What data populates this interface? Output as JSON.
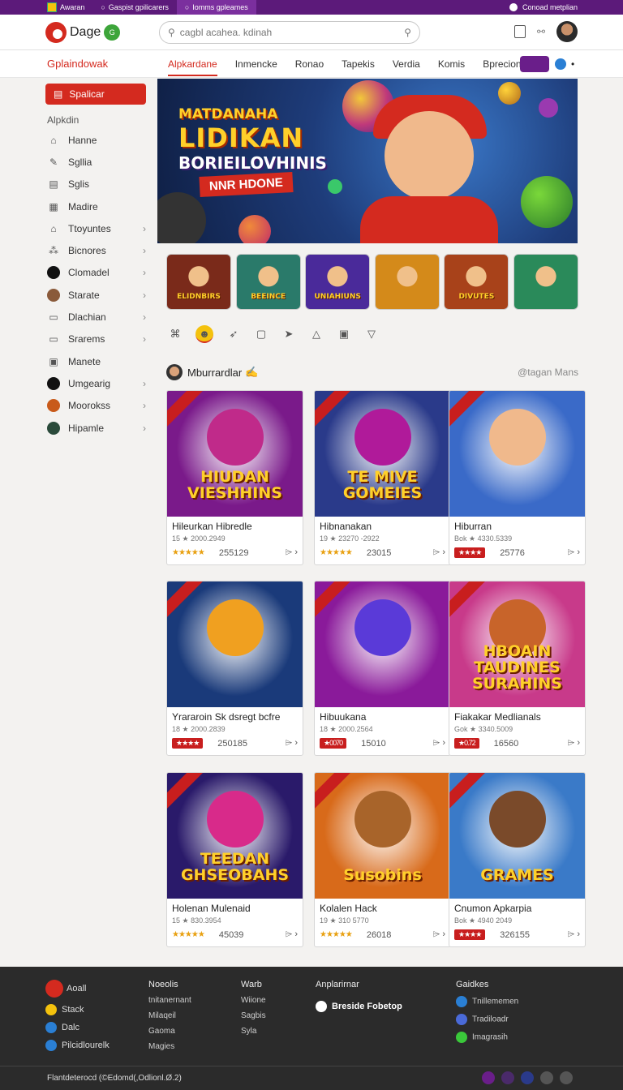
{
  "topbar": {
    "tabs": [
      "Awaran",
      "Gaspist gpilicarers",
      "Iomms gpleames"
    ],
    "right_text": "Conoad metplian"
  },
  "header": {
    "logo_text": "Dage",
    "logo_badge": "G",
    "search_placeholder": "cagbl acahea. kdinah"
  },
  "nav": {
    "brand": "Gplaindowak",
    "items": [
      "Alpkardane",
      "Inmencke",
      "Ronao",
      "Tapekis",
      "Verdia",
      "Komis",
      "Bprecion"
    ],
    "more_glyph": "⌄",
    "extra_glyph": "•"
  },
  "sidebar": {
    "button_label": "Spalicar",
    "heading": "Alpkdin",
    "items": [
      {
        "label": "Hanne",
        "icon": "home-icon",
        "chevron": false
      },
      {
        "label": "Sgllia",
        "icon": "edit-icon",
        "chevron": false
      },
      {
        "label": "Sglis",
        "icon": "document-icon",
        "chevron": false
      },
      {
        "label": "Madire",
        "icon": "grid-icon",
        "chevron": false
      },
      {
        "label": "Ttoyuntes",
        "icon": "home-icon",
        "chevron": true
      },
      {
        "label": "Bicnores",
        "icon": "cluster-icon",
        "chevron": true
      },
      {
        "label": "Clomadel",
        "icon": "circle-dark-icon",
        "chevron": true
      },
      {
        "label": "Starate",
        "icon": "avatar-icon",
        "chevron": true
      },
      {
        "label": "Dlachian",
        "icon": "folder-icon",
        "chevron": true
      },
      {
        "label": "Srarems",
        "icon": "card-icon",
        "chevron": true
      },
      {
        "label": "Manete",
        "icon": "image-icon",
        "chevron": false
      },
      {
        "label": "Umgearig",
        "icon": "shield-icon",
        "chevron": true
      },
      {
        "label": "Moorokss",
        "icon": "orange-badge-icon",
        "chevron": true
      },
      {
        "label": "Hipamle",
        "icon": "globe-icon",
        "chevron": true
      }
    ]
  },
  "banner": {
    "line1": "MATDANAHA",
    "line2": "LIDIKAN",
    "line3": "BORIEILOVHINIS",
    "ribbon": "NNR HDONE"
  },
  "thumbs": [
    {
      "label": "ELIDNBIRS",
      "bg": "#7a2a1a"
    },
    {
      "label": "BEEINCE",
      "bg": "#2a7a6a"
    },
    {
      "label": "UNIAHIUNS",
      "bg": "#4a2a9a"
    },
    {
      "label": "",
      "bg": "#d48a1a"
    },
    {
      "label": "DIVUTES",
      "bg": "#a8421a"
    },
    {
      "label": "",
      "bg": "#2a8a5a"
    }
  ],
  "tools": [
    "controller-icon",
    "emoji-icon",
    "rocket-icon",
    "square-icon",
    "pin-icon",
    "flask-icon",
    "box-icon",
    "triangle-icon"
  ],
  "section": {
    "title": "Mburrardlar",
    "title_glyph": "✍",
    "right": "@tagan Mans"
  },
  "cards": [
    {
      "art": "HIUDAN VIESHHINS",
      "bg": "#7a1a8a",
      "char": "#c02a8a",
      "name": "Hileurkan Hibredle",
      "meta": "15 ★ 2000.2949",
      "rating": "★★★★★",
      "badge": false,
      "count": "255129"
    },
    {
      "art": "TE MIVE GOMEIES",
      "bg": "#2a3a8a",
      "char": "#b01a9a",
      "name": "Hibnanakan",
      "meta": "19 ★ 23270 -2922",
      "rating": "★★★★★",
      "badge": false,
      "count": "23015"
    },
    {
      "art": "",
      "bg": "#3a6ac8",
      "char": "#f0b98c",
      "name": "Hiburran",
      "meta": "Bok ★ 4330.5339",
      "rating": "★★★★",
      "badge": true,
      "count": "25776"
    },
    {
      "art": "",
      "bg": "#1a3a7a",
      "char": "#f0a020",
      "name": "Yrararoin Sk dsregt bcfre",
      "meta": "18 ★ 2000.2839",
      "rating": "★★★★",
      "badge": true,
      "count": "250185"
    },
    {
      "art": "",
      "bg": "#8a1a9a",
      "char": "#5a3ad8",
      "name": "Hibuukana",
      "meta": "18 ★ 2000.2564",
      "rating": "★0070",
      "badge": true,
      "count": "15010"
    },
    {
      "art": "HBOAIN TAUDINES SURAHINS",
      "bg": "#c83a8a",
      "char": "#c8642a",
      "name": "Fiakakar Medlianals",
      "meta": "Gok ★ 3340.5009",
      "rating": "★0.72",
      "badge": true,
      "count": "16560"
    },
    {
      "art": "TEEDAN GHSEOBAHS",
      "bg": "#2a1a6a",
      "char": "#d82a8a",
      "name": "Holenan Mulenaid",
      "meta": "15 ★ 830.3954",
      "rating": "★★★★★",
      "badge": false,
      "count": "45039"
    },
    {
      "art": "Susobins",
      "bg": "#d86a1a",
      "char": "#a8642a",
      "name": "Kolalen Hack",
      "meta": "19 ★ 310 5770",
      "rating": "★★★★★",
      "badge": false,
      "count": "26018"
    },
    {
      "art": "GRAMES",
      "bg": "#3a7ac8",
      "char": "#7a4a2a",
      "name": "Cnumon Apkarpia",
      "meta": "Bok ★ 4940 2049",
      "rating": "★★★★",
      "badge": true,
      "count": "326155"
    }
  ],
  "footer": {
    "col1": {
      "brand": "Aoall",
      "items": [
        "Stack",
        "Dalc",
        "Pilcidlourelk"
      ]
    },
    "col2": {
      "head": "Noeolis",
      "items": [
        "tnitanernant",
        "Milaqeil",
        "Gaoma",
        "Magies"
      ]
    },
    "col3": {
      "head": "Warb",
      "items": [
        "Wiione",
        "Sagbis",
        "Syla"
      ]
    },
    "col4": {
      "head": "Anplarirnar",
      "button": "Breside Fobetop"
    },
    "col5": {
      "head": "Gaidkes",
      "items": [
        "Tnillememen",
        "Tradiloadr",
        "Imagrasih"
      ]
    },
    "copyright": "Flantdeterocd (©Edomd(,Odlionl.Ø.2)"
  },
  "colors": {
    "accent": "#d42a1f",
    "topbar": "#5c1a7a",
    "footer": "#2b2b2b",
    "star": "#e8a010"
  }
}
